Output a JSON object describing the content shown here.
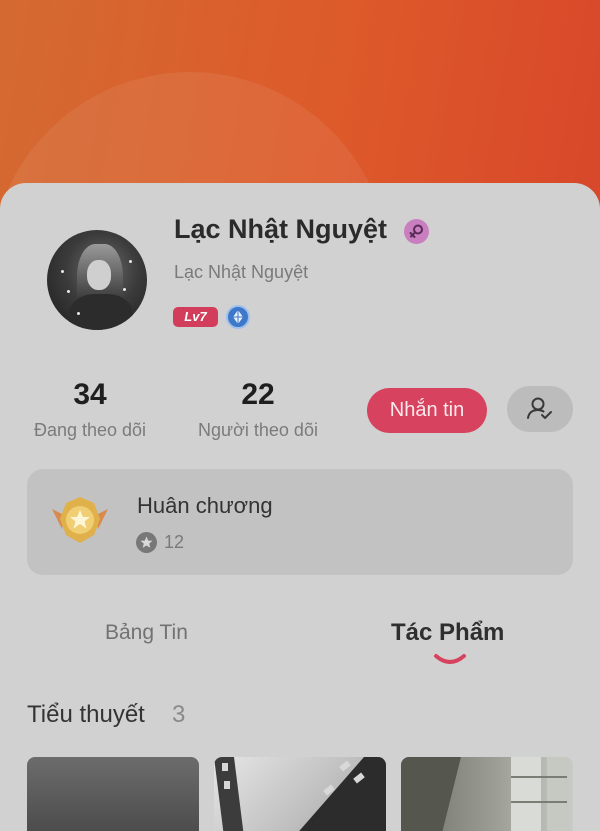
{
  "profile": {
    "display_name": "Lạc Nhật Nguyệt",
    "username": "Lạc Nhật Nguyệt",
    "level_badge": "Lv7",
    "gender_icon": "female-icon",
    "avatar_icon": "avatar"
  },
  "stats": {
    "following_count": "34",
    "following_label": "Đang theo dõi",
    "followers_count": "22",
    "followers_label": "Người theo dõi"
  },
  "actions": {
    "message_label": "Nhắn tin",
    "follow_icon": "user-check-icon"
  },
  "medals": {
    "title": "Huân chương",
    "count": "12"
  },
  "tabs": [
    {
      "label": "Bảng Tin",
      "active": false
    },
    {
      "label": "Tác Phẩm",
      "active": true
    }
  ],
  "section": {
    "title": "Tiểu thuyết",
    "count": "3"
  },
  "colors": {
    "header_accent": "#dd5a2a",
    "primary_button": "#d7425e",
    "level_badge": "#d23d5b",
    "gem_badge": "#3d78c9",
    "gender_badge": "#c97fbf"
  }
}
